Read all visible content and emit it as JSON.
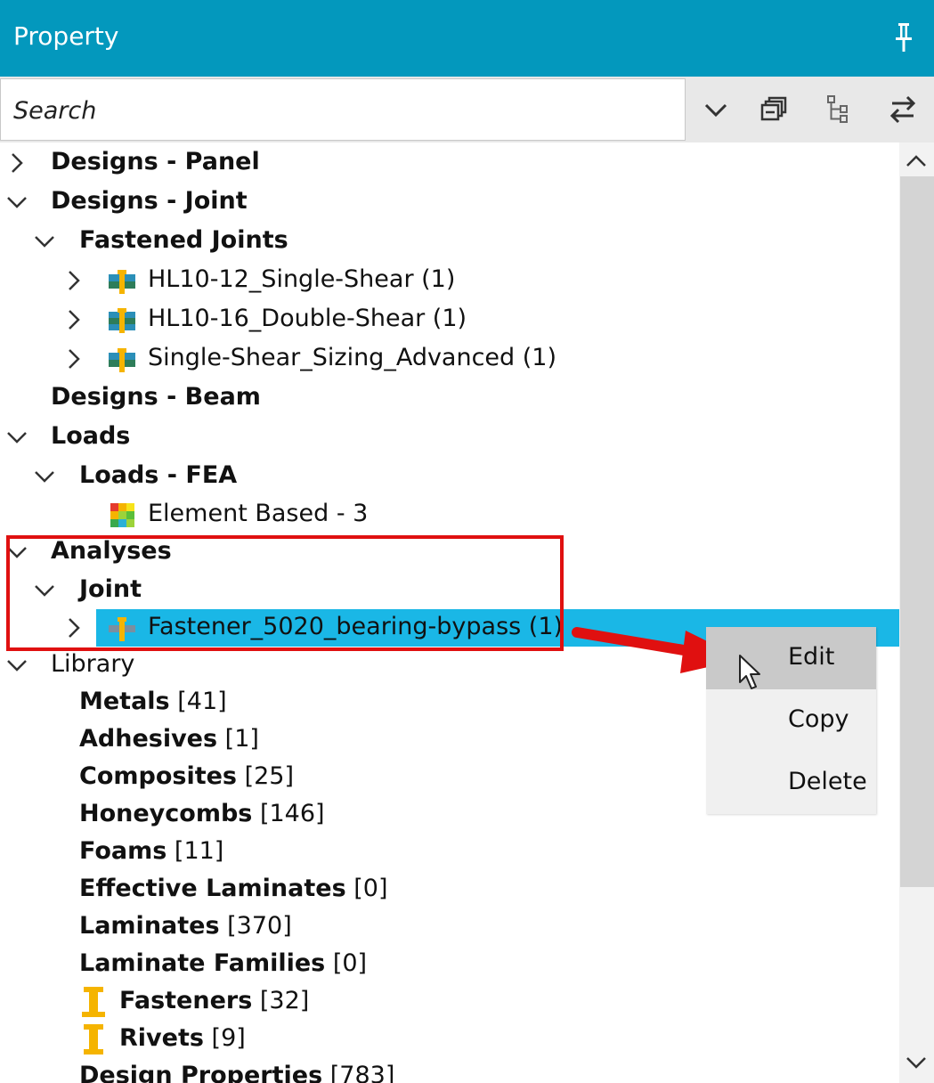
{
  "header": {
    "title": "Property"
  },
  "search": {
    "placeholder": "Search"
  },
  "toolbar": {
    "icons": [
      "chevron-down-icon",
      "collapse-all-icon",
      "tree-view-icon",
      "swap-icon"
    ]
  },
  "tree": {
    "designs_panel": "Designs - Panel",
    "designs_joint": "Designs - Joint",
    "fastened_joints": "Fastened Joints",
    "joint_1": "HL10-12_Single-Shear (1)",
    "joint_2": "HL10-16_Double-Shear (1)",
    "joint_3": "Single-Shear_Sizing_Advanced (1)",
    "designs_beam": "Designs - Beam",
    "loads": "Loads",
    "loads_fea": "Loads - FEA",
    "element_based": "Element Based - 3",
    "analyses": "Analyses",
    "joint": "Joint",
    "fastener_analysis": "Fastener_5020_bearing-bypass (1)",
    "library": "Library",
    "library_items": [
      {
        "name": "Metals",
        "count": "[41]"
      },
      {
        "name": "Adhesives",
        "count": "[1]"
      },
      {
        "name": "Composites",
        "count": "[25]"
      },
      {
        "name": "Honeycombs",
        "count": "[146]"
      },
      {
        "name": "Foams",
        "count": "[11]"
      },
      {
        "name": "Effective Laminates",
        "count": "[0]"
      },
      {
        "name": "Laminates",
        "count": "[370]"
      },
      {
        "name": "Laminate Families",
        "count": "[0]"
      },
      {
        "name": "Fasteners",
        "count": "[32]"
      },
      {
        "name": "Rivets",
        "count": "[9]"
      },
      {
        "name": "Design Properties",
        "count": "[783]"
      }
    ]
  },
  "context_menu": {
    "items": [
      "Edit",
      "Copy",
      "Delete"
    ]
  },
  "colors": {
    "header": "#0398bd",
    "selection": "#1ab7e6",
    "annotation": "#e01010"
  }
}
